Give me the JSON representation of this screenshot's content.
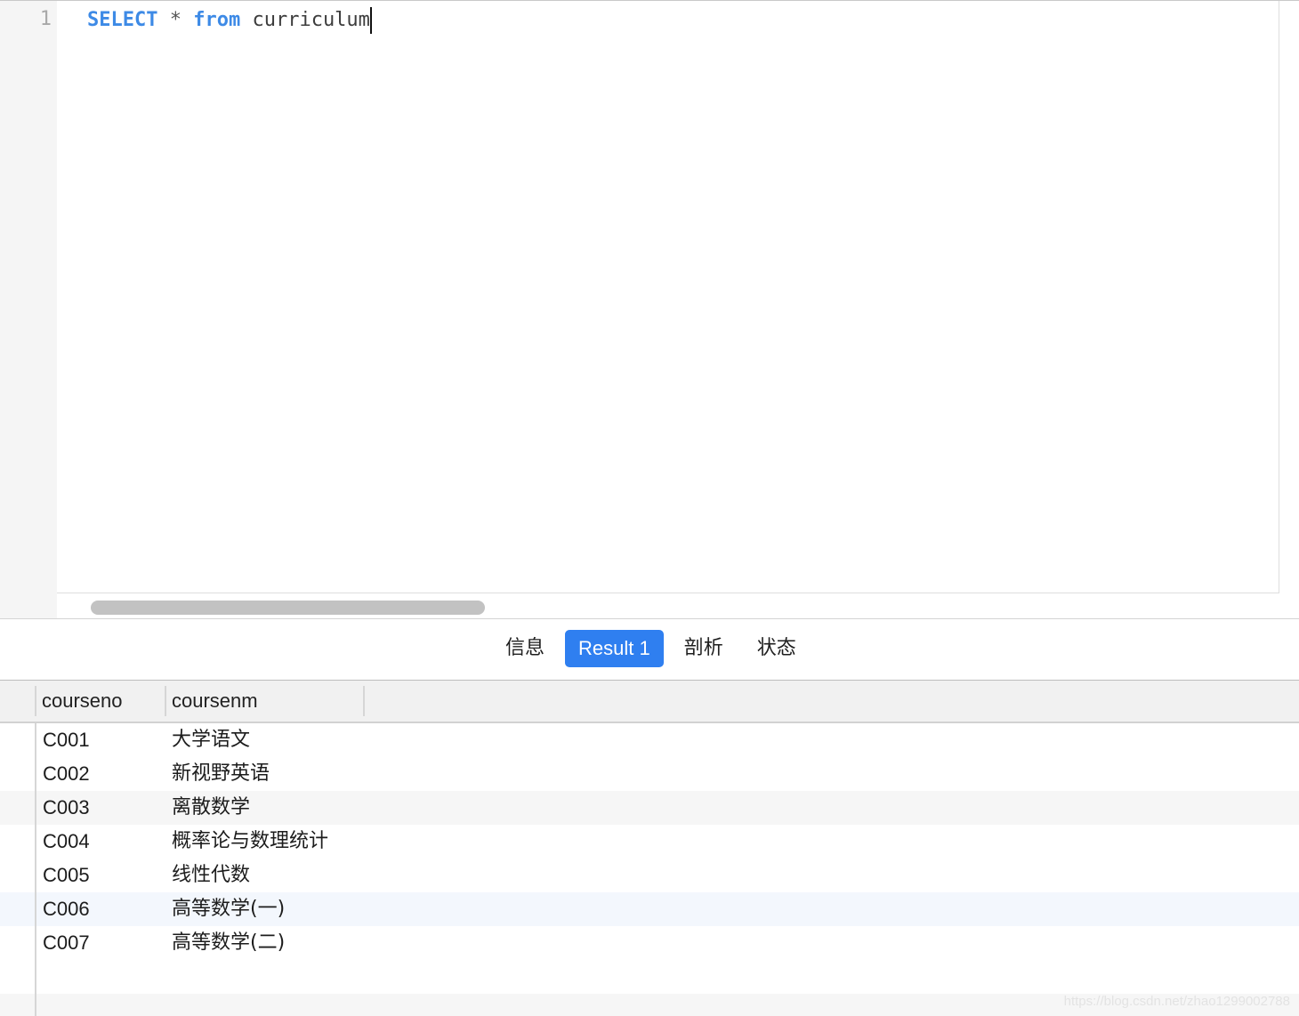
{
  "editor": {
    "line_numbers": [
      "1"
    ],
    "query": {
      "keyword_select": "SELECT",
      "operator_star": "*",
      "keyword_from": "from",
      "table": "curriculum"
    }
  },
  "tabs": [
    {
      "label": "信息",
      "active": false
    },
    {
      "label": "Result 1",
      "active": true
    },
    {
      "label": "剖析",
      "active": false
    },
    {
      "label": "状态",
      "active": false
    }
  ],
  "grid": {
    "columns": [
      "courseno",
      "coursenm"
    ],
    "rows": [
      [
        "C001",
        "大学语文"
      ],
      [
        "C002",
        "新视野英语"
      ],
      [
        "C003",
        "离散数学"
      ],
      [
        "C004",
        "概率论与数理统计"
      ],
      [
        "C005",
        "线性代数"
      ],
      [
        "C006",
        "高等数学(一)"
      ],
      [
        "C007",
        "高等数学(二)"
      ]
    ]
  },
  "watermark": "https://blog.csdn.net/zhao1299002788",
  "colors": {
    "keyword": "#3d8ae6",
    "active_tab": "#2f7ff0",
    "gutter": "#f5f5f5"
  }
}
